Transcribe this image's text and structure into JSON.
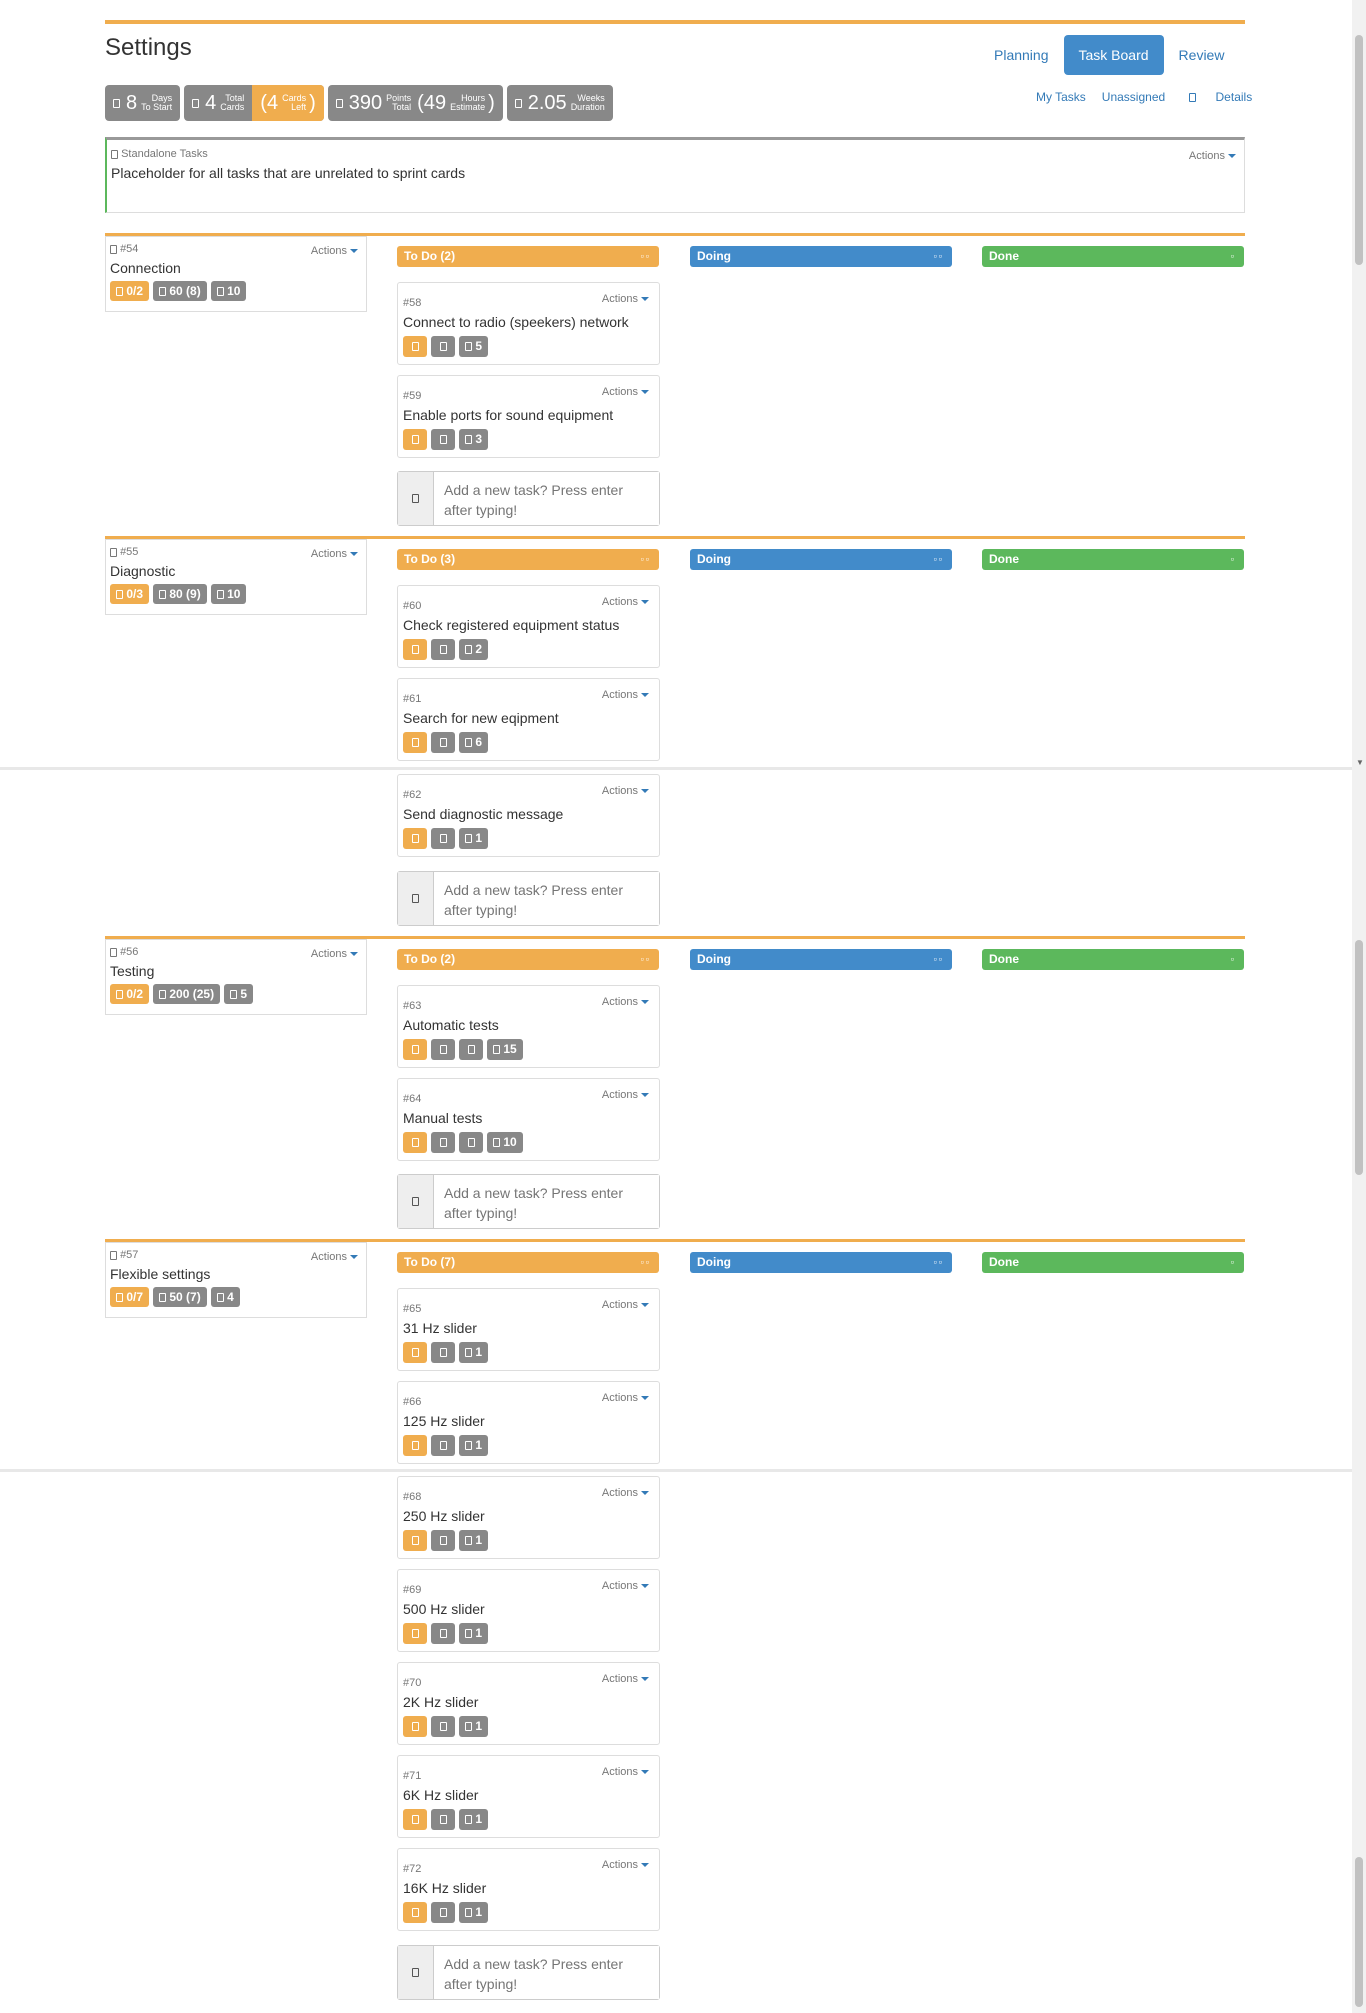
{
  "page": {
    "title": "Settings"
  },
  "nav": {
    "tabs": [
      {
        "label": "Planning"
      },
      {
        "label": "Task Board"
      },
      {
        "label": "Review"
      }
    ]
  },
  "stats": {
    "days": {
      "value": "8",
      "top": "Days",
      "bottom": "To Start"
    },
    "cards": {
      "value": "4",
      "top": "Total",
      "bottom": "Cards"
    },
    "cards_left": {
      "value": "(4",
      "top": "Cards",
      "bottom": "Left",
      "close": ")"
    },
    "points": {
      "value": "390",
      "top": "Points",
      "bottom": "Total"
    },
    "hours": {
      "value": "(49",
      "top": "Hours",
      "bottom": "Estimate",
      "close": ")"
    },
    "weeks": {
      "value": "2.05",
      "top": "Weeks",
      "bottom": "Duration"
    }
  },
  "filters": {
    "my_tasks": "My Tasks",
    "unassigned": "Unassigned",
    "details": "Details"
  },
  "standalone": {
    "label": "Standalone Tasks",
    "text": "Placeholder for all tasks that are unrelated to sprint cards",
    "actions": "Actions"
  },
  "new_task_placeholder": "Add a new task? Press enter after typing!",
  "columns": {
    "doing": "Doing",
    "done": "Done"
  },
  "stories": [
    {
      "num": "#54",
      "name": "Connection",
      "actions": "Actions",
      "b1": "0/2",
      "b2": "60 (8)",
      "b3": "10",
      "todo": "To Do (2)",
      "tasks": [
        {
          "num": "#58",
          "name": "Connect to radio (speekers) network",
          "est": "5"
        },
        {
          "num": "#59",
          "name": "Enable ports for sound equipment",
          "est": "3"
        }
      ]
    },
    {
      "num": "#55",
      "name": "Diagnostic",
      "actions": "Actions",
      "b1": "0/3",
      "b2": "80 (9)",
      "b3": "10",
      "todo": "To Do (3)",
      "tasks": [
        {
          "num": "#60",
          "name": "Check registered equipment status",
          "est": "2"
        },
        {
          "num": "#61",
          "name": "Search for new eqipment",
          "est": "6"
        },
        {
          "num": "#62",
          "name": "Send diagnostic message",
          "est": "1"
        }
      ]
    },
    {
      "num": "#56",
      "name": "Testing",
      "actions": "Actions",
      "b1": "0/2",
      "b2": "200 (25)",
      "b3": "5",
      "todo": "To Do (2)",
      "tasks": [
        {
          "num": "#63",
          "name": "Automatic tests",
          "est": "15"
        },
        {
          "num": "#64",
          "name": "Manual tests",
          "est": "10"
        }
      ]
    },
    {
      "num": "#57",
      "name": "Flexible settings",
      "actions": "Actions",
      "b1": "0/7",
      "b2": "50 (7)",
      "b3": "4",
      "todo": "To Do (7)",
      "tasks": [
        {
          "num": "#65",
          "name": "31 Hz slider",
          "est": "1"
        },
        {
          "num": "#66",
          "name": "125 Hz slider",
          "est": "1"
        },
        {
          "num": "#68",
          "name": "250 Hz slider",
          "est": "1"
        },
        {
          "num": "#69",
          "name": "500 Hz slider",
          "est": "1"
        },
        {
          "num": "#70",
          "name": "2K Hz slider",
          "est": "1"
        },
        {
          "num": "#71",
          "name": "6K Hz slider",
          "est": "1"
        },
        {
          "num": "#72",
          "name": "16K Hz slider",
          "est": "1"
        }
      ]
    }
  ],
  "task_actions": "Actions"
}
